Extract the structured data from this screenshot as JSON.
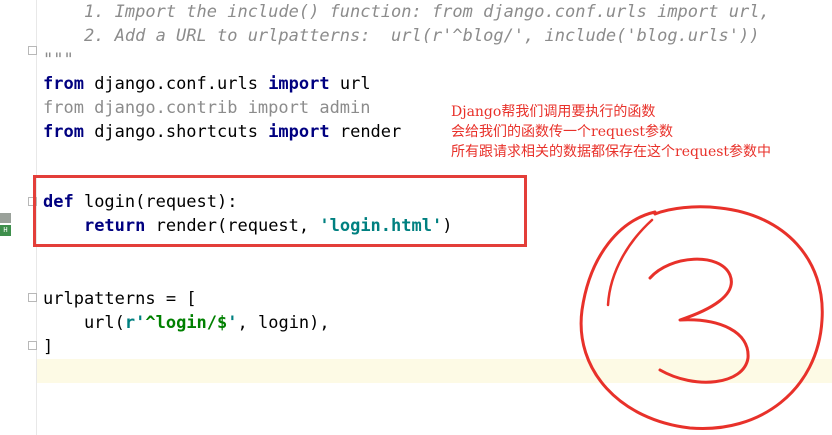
{
  "editor": {
    "lines": [
      {
        "id": "docstring_line1",
        "tokens": [
          {
            "t": "comment",
            "v": "    1. Import the include() function: from django.conf.urls import url,"
          }
        ]
      },
      {
        "id": "docstring_line2",
        "tokens": [
          {
            "t": "comment",
            "v": "    2. Add a URL to urlpatterns:  url(r'^blog/', include('blog.urls'))"
          }
        ]
      },
      {
        "id": "docstring_end",
        "tokens": [
          {
            "t": "comment",
            "v": "\"\"\""
          }
        ]
      },
      {
        "id": "import_url",
        "tokens": [
          {
            "t": "kw",
            "v": "from"
          },
          {
            "t": "plain",
            "v": " django.conf.urls "
          },
          {
            "t": "kw",
            "v": "import"
          },
          {
            "t": "plain",
            "v": " url"
          }
        ]
      },
      {
        "id": "import_admin",
        "tokens": [
          {
            "t": "comment-plain",
            "v": "from django.contrib import admin"
          }
        ]
      },
      {
        "id": "import_render",
        "tokens": [
          {
            "t": "kw",
            "v": "from"
          },
          {
            "t": "plain",
            "v": " django.shortcuts "
          },
          {
            "t": "kw",
            "v": "import"
          },
          {
            "t": "plain",
            "v": " render"
          }
        ]
      },
      {
        "id": "def_login",
        "tokens": [
          {
            "t": "kw",
            "v": "def"
          },
          {
            "t": "plain",
            "v": " login(request):"
          }
        ]
      },
      {
        "id": "return_render",
        "tokens": [
          {
            "t": "plain",
            "v": "    "
          },
          {
            "t": "kw",
            "v": "return"
          },
          {
            "t": "plain",
            "v": " render(request, "
          },
          {
            "t": "str",
            "v": "'login.html'"
          },
          {
            "t": "plain",
            "v": ")"
          }
        ]
      },
      {
        "id": "urlpatterns_open",
        "tokens": [
          {
            "t": "plain",
            "v": "urlpatterns = ["
          }
        ]
      },
      {
        "id": "url_login",
        "tokens": [
          {
            "t": "plain",
            "v": "    url("
          },
          {
            "t": "str",
            "v": "r'"
          },
          {
            "t": "str2",
            "v": "^login/$"
          },
          {
            "t": "str",
            "v": "'"
          },
          {
            "t": "plain",
            "v": ", login),"
          }
        ]
      },
      {
        "id": "urlpatterns_close",
        "tokens": [
          {
            "t": "plain",
            "v": "]"
          }
        ]
      }
    ]
  },
  "annotation": {
    "note_line1": "Django帮我们调用要执行的函数",
    "note_line2": "会给我们的函数传一个request参数",
    "note_line3": "所有跟请求相关的数据都保存在这个request参数中",
    "color": "#e8312a"
  },
  "gutter": {
    "marker_label": "H"
  }
}
